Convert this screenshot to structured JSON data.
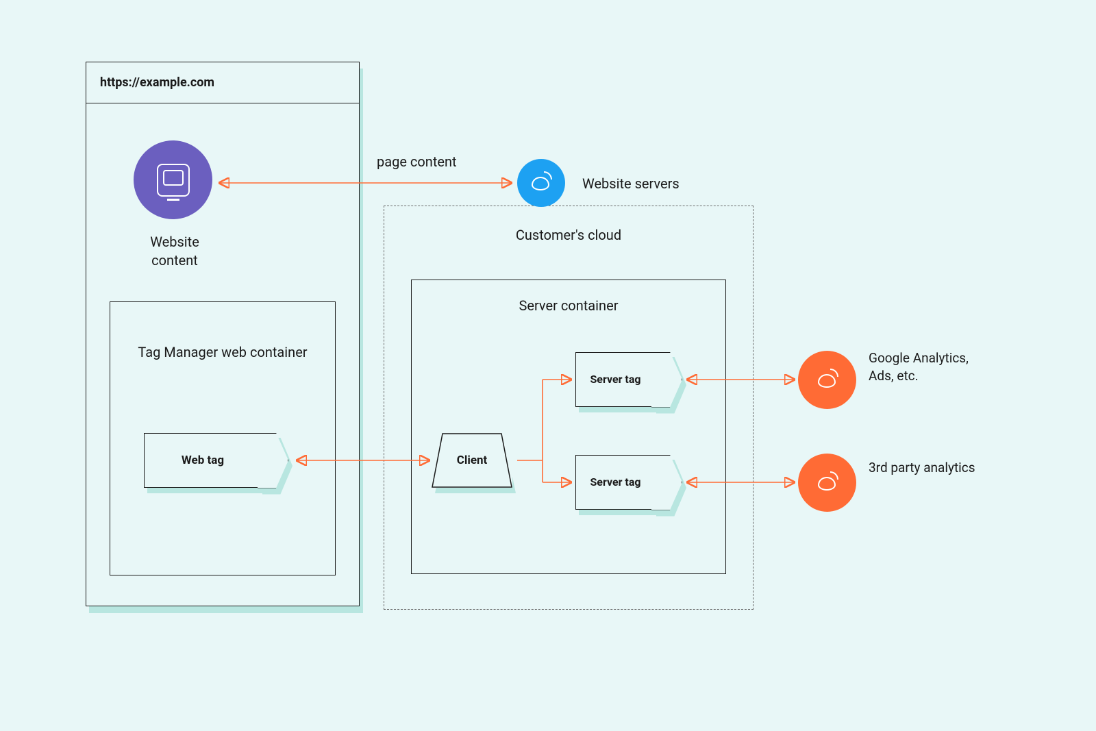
{
  "browser": {
    "address": "https://example.com"
  },
  "labels": {
    "page_content": "page content",
    "website_content": "Website content",
    "website_servers": "Website servers",
    "customers_cloud": "Customer's cloud",
    "tag_manager": "Tag Manager web container",
    "web_tag": "Web tag",
    "server_container": "Server container",
    "client": "Client",
    "server_tag_1": "Server tag",
    "server_tag_2": "Server tag",
    "google_analytics": "Google Analytics, Ads, etc.",
    "third_party": "3rd party analytics"
  },
  "colors": {
    "orange": "#ff6b35",
    "purple": "#6b5fbf",
    "blue": "#1da1f2",
    "background": "#e8f7f7",
    "teal_shadow": "#b8e6e0"
  }
}
